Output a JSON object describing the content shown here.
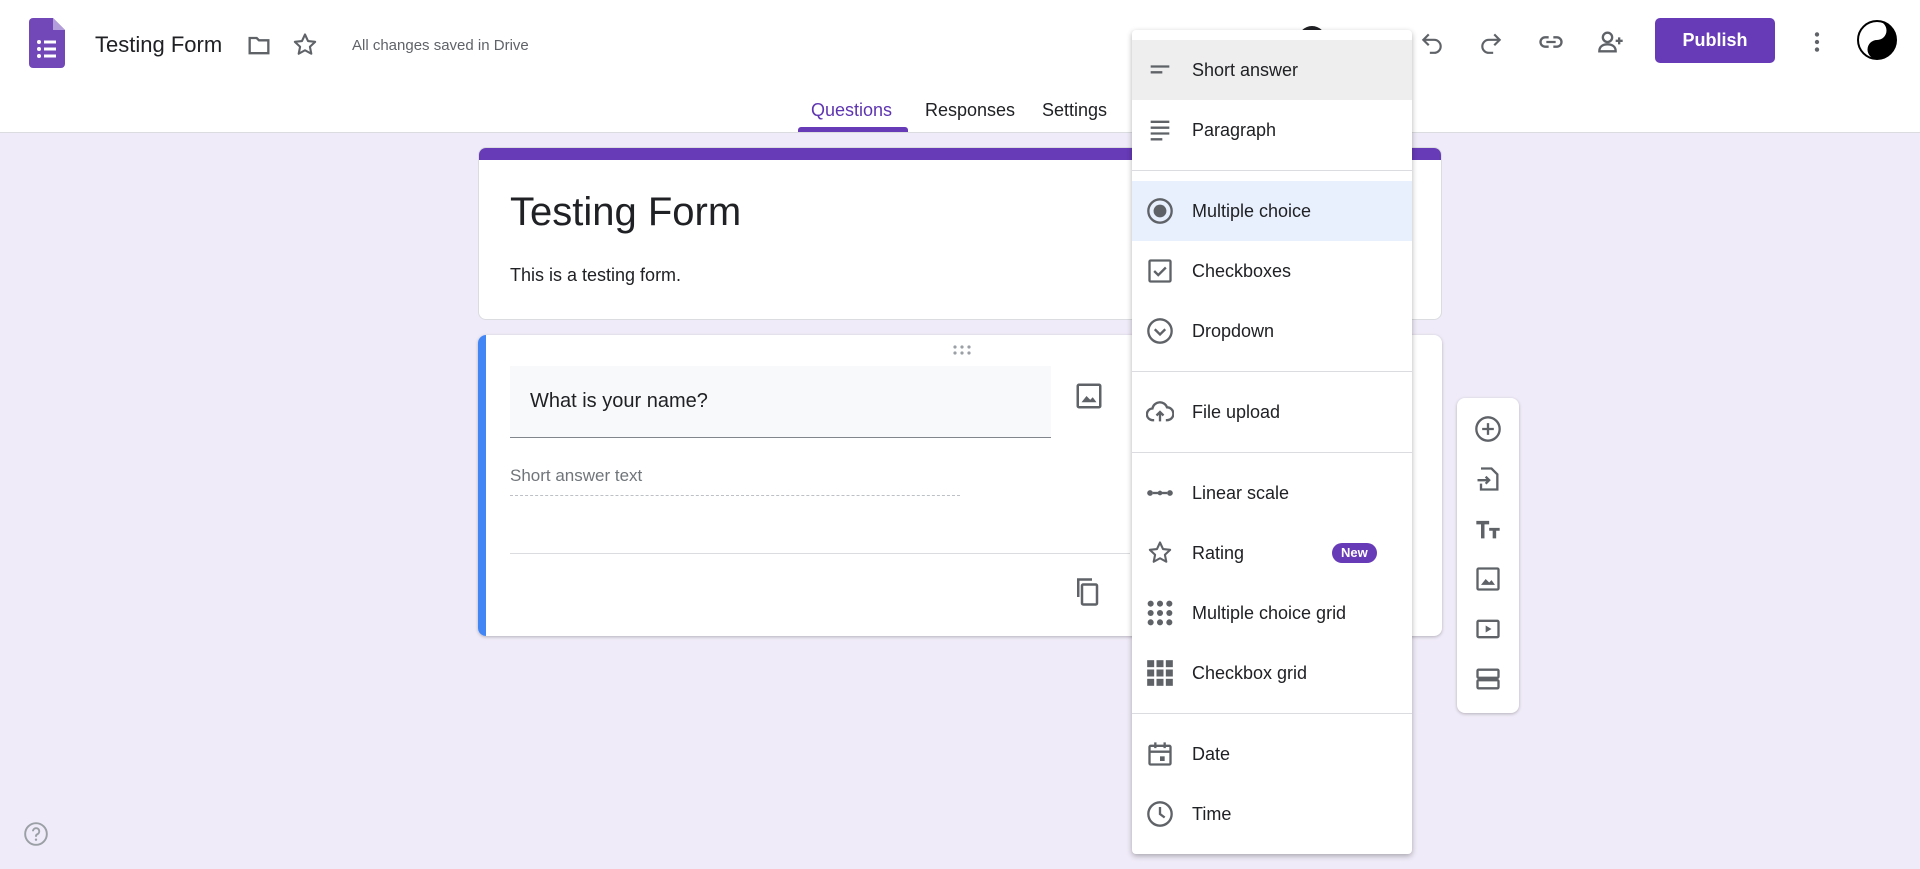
{
  "header": {
    "doc_title": "Testing Form",
    "save_status": "All changes saved in Drive",
    "publish_label": "Publish"
  },
  "tabs": {
    "questions": "Questions",
    "responses": "Responses",
    "settings": "Settings"
  },
  "form": {
    "title": "Testing Form",
    "description": "This is a testing form."
  },
  "question": {
    "title": "What is your name?",
    "answer_placeholder": "Short answer text"
  },
  "menu": {
    "items": [
      {
        "label": "Short answer",
        "icon": "short-answer-icon"
      },
      {
        "label": "Paragraph",
        "icon": "paragraph-icon"
      },
      {
        "label": "Multiple choice",
        "icon": "radio-button-icon"
      },
      {
        "label": "Checkboxes",
        "icon": "checkbox-icon"
      },
      {
        "label": "Dropdown",
        "icon": "dropdown-circle-icon"
      },
      {
        "label": "File upload",
        "icon": "cloud-upload-icon"
      },
      {
        "label": "Linear scale",
        "icon": "linear-scale-icon"
      },
      {
        "label": "Rating",
        "icon": "star-outline-icon"
      },
      {
        "label": "Multiple choice grid",
        "icon": "dot-grid-icon"
      },
      {
        "label": "Checkbox grid",
        "icon": "square-grid-icon"
      },
      {
        "label": "Date",
        "icon": "calendar-icon"
      },
      {
        "label": "Time",
        "icon": "clock-icon"
      }
    ],
    "new_badge": "New"
  },
  "colors": {
    "accent": "#673ab7",
    "background": "#f0ebf8",
    "question_bar": "#4285f4"
  }
}
